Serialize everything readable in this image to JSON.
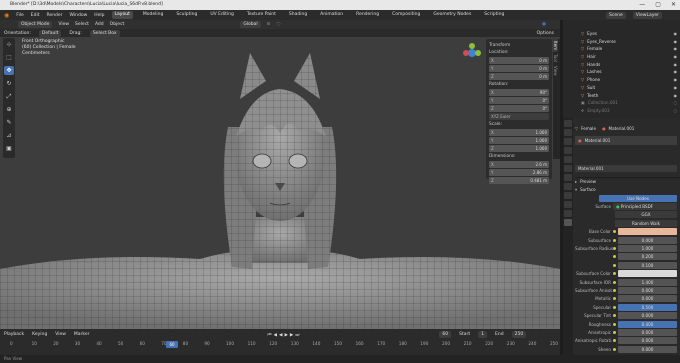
{
  "window": {
    "title": "Blender* [D:\\3d\\Models\\Characters\\Lucia\\Lucia\\lucia_S6dP.v8.blend]",
    "controls": [
      "—",
      "▢",
      "✕"
    ]
  },
  "menu": {
    "items": [
      "File",
      "Edit",
      "Render",
      "Window",
      "Help"
    ],
    "workspaces": [
      "Layout",
      "Modeling",
      "Sculpting",
      "UV Editing",
      "Texture Paint",
      "Shading",
      "Animation",
      "Rendering",
      "Compositing",
      "Geometry Nodes",
      "Scripting"
    ],
    "active_workspace": "Layout",
    "scene_label": "Scene",
    "view_layer_label": "ViewLayer"
  },
  "viewport_header": {
    "mode": "Object Mode",
    "menus": [
      "View",
      "Select",
      "Add",
      "Object"
    ],
    "orientation": "Global",
    "orientation_label": "Orientation:",
    "orientation_value": "Default",
    "drag_label": "Drag:",
    "drag_value": "Select Box",
    "options": "Options"
  },
  "viewport_info": {
    "line1": "Front Orthographic",
    "line2": "(60) Collection | Female",
    "line3": "Centimeters"
  },
  "toolbar": {
    "tools": [
      "cursor",
      "select",
      "move",
      "rotate",
      "scale",
      "transform",
      "annotate",
      "measure",
      "add-cube"
    ],
    "active_tool_index": 2
  },
  "transform_panel": {
    "header": "Transform",
    "location_label": "Location:",
    "location": [
      {
        "axis": "X",
        "value": "0 m"
      },
      {
        "axis": "Y",
        "value": "0 m"
      },
      {
        "axis": "Z",
        "value": "0 m"
      }
    ],
    "rotation_label": "Rotation:",
    "rotation": [
      {
        "axis": "X",
        "value": "90°"
      },
      {
        "axis": "Y",
        "value": "0°"
      },
      {
        "axis": "Z",
        "value": "0°"
      }
    ],
    "rotation_mode": "XYZ Euler",
    "scale_label": "Scale:",
    "scale": [
      {
        "axis": "X",
        "value": "1.000"
      },
      {
        "axis": "Y",
        "value": "1.000"
      },
      {
        "axis": "Z",
        "value": "1.000"
      }
    ],
    "dimensions_label": "Dimensions:",
    "dimensions": [
      {
        "axis": "X",
        "value": "2.6 m"
      },
      {
        "axis": "Y",
        "value": "2.86 m"
      },
      {
        "axis": "Z",
        "value": "0.481 m"
      }
    ],
    "tabs": [
      "Item",
      "Tool",
      "View"
    ]
  },
  "outliner": {
    "items": [
      "Eyes",
      "Eyes_Reverse",
      "Female",
      "Hair",
      "Hands",
      "Lashes",
      "Phone",
      "Suit",
      "Teeth",
      "Collection.001",
      "Empty.003"
    ]
  },
  "properties": {
    "object_name": "Female",
    "material_name": "Material.001",
    "material_slot": "Material.001",
    "section_preview": "Preview",
    "section_surface": "Surface",
    "use_nodes": "Use Nodes",
    "surface_label": "Surface",
    "surface_value": "Principled BSDF",
    "distribution": "GGX",
    "subsurface_method": "Random Walk",
    "rows": [
      {
        "label": "Base Color",
        "value": "",
        "kind": "swatch"
      },
      {
        "label": "Subsurface",
        "value": "0.000",
        "kind": "field"
      },
      {
        "label": "Subsurface Radius",
        "value": "1.000",
        "kind": "field"
      },
      {
        "label": "",
        "value": "0.200",
        "kind": "field"
      },
      {
        "label": "",
        "value": "0.100",
        "kind": "field"
      },
      {
        "label": "Subsurface Color",
        "value": "",
        "kind": "white"
      },
      {
        "label": "Subsurface IOR",
        "value": "1.400",
        "kind": "field"
      },
      {
        "label": "Subsurface Anisot...",
        "value": "0.000",
        "kind": "field"
      },
      {
        "label": "Metallic",
        "value": "0.000",
        "kind": "field"
      },
      {
        "label": "Specular",
        "value": "0.500",
        "kind": "blue"
      },
      {
        "label": "Specular Tint",
        "value": "0.000",
        "kind": "field"
      },
      {
        "label": "Roughness",
        "value": "0.400",
        "kind": "blue"
      },
      {
        "label": "Anisotropic",
        "value": "0.000",
        "kind": "field"
      },
      {
        "label": "Anisotropic Rotati...",
        "value": "0.000",
        "kind": "field"
      },
      {
        "label": "Sheen",
        "value": "0.000",
        "kind": "field"
      }
    ]
  },
  "timeline": {
    "menus": [
      "Playback",
      "Keying",
      "View",
      "Marker"
    ],
    "current_frame": "60",
    "start_label": "Start",
    "start_value": "1",
    "end_label": "End",
    "end_value": "250",
    "ticks": [
      "0",
      "10",
      "20",
      "30",
      "40",
      "50",
      "60",
      "70",
      "80",
      "90",
      "100",
      "110",
      "120",
      "130",
      "140",
      "150",
      "160",
      "170",
      "180",
      "190",
      "200",
      "210",
      "220",
      "230",
      "240",
      "250"
    ]
  },
  "status": {
    "text": "Pan View"
  }
}
